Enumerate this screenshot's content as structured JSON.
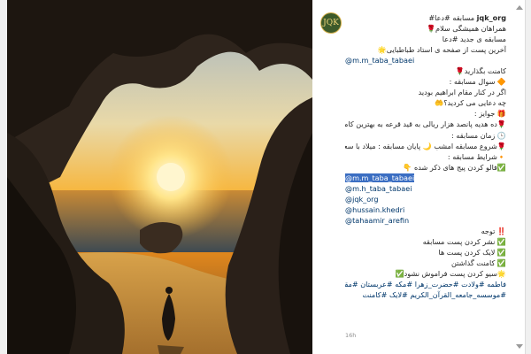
{
  "post": {
    "username": "jqk_org",
    "avatar_text": "JQK",
    "caption_lines": [
      {
        "text": "مسابقه #دعا#",
        "style": "normal",
        "prefix_user": true
      },
      {
        "text": "همراهان همیشگی سلام🌹",
        "style": "normal"
      },
      {
        "text": "مسابقه ی جدید #دعا",
        "style": "normal"
      },
      {
        "text": "آخرین پست از صفحه ی استاد طباطبایی🌟",
        "style": "normal"
      },
      {
        "text": "@m.m_taba_tabaei",
        "style": "mention"
      },
      {
        "text": "کامنت بگذارید🌹",
        "style": "normal"
      },
      {
        "text": "🔶 سوال مسابقه :",
        "style": "normal"
      },
      {
        "text": "اگر در کنار مقام ابراهیم بودید",
        "style": "normal"
      },
      {
        "text": "چه دعایی می کردید؟🤲",
        "style": "normal"
      },
      {
        "text": "🎁 جوایز :",
        "style": "normal"
      },
      {
        "text": "🌹ده هدیه پانصد هزار ریالی به قید قرعه به بهترین کامنت ها",
        "style": "normal"
      },
      {
        "text": "🕒 زمان مسابقه :",
        "style": "normal"
      },
      {
        "text": "🌹شروع مسابقه امشب 🌙 پایان مسابقه : میلاد با سعادت حضرت فاطمه (س)",
        "style": "normal"
      },
      {
        "text": "🔸شرایط مسابقه :",
        "style": "normal"
      },
      {
        "text": "✅فالو کردن پیج های ذکر شده 👇",
        "style": "normal"
      },
      {
        "text": "@m.m_taba_tabaei",
        "style": "mention-selected"
      },
      {
        "text": "@m.h_taba_tabaei",
        "style": "mention"
      },
      {
        "text": "@jqk_org",
        "style": "mention"
      },
      {
        "text": "@hussain.khedri",
        "style": "mention"
      },
      {
        "text": "@tahaamir_arefin",
        "style": "mention"
      },
      {
        "text": "‼️ توجه",
        "style": "normal"
      },
      {
        "text": "✅ نشر کردن پست مسابقه",
        "style": "normal"
      },
      {
        "text": "✅ لایک کردن پست ها",
        "style": "normal"
      },
      {
        "text": "✅ کامنت گذاشتن",
        "style": "normal"
      },
      {
        "text": "🌟سیو کردن پست فراموش نشود✅",
        "style": "normal"
      },
      {
        "text": "فاطمه #ولادت #حضرت_زهرا #مکه #عربستان #مقام_ابراهیم #کعبه #طباطبایی",
        "style": "link"
      },
      {
        "text": "#موسسه_جامعه_القرآن_الکریم #لایک #کامنت",
        "style": "link"
      }
    ],
    "timestamp": "16h"
  },
  "photo": {
    "description_icon": "cave-sunset-photo"
  },
  "colors": {
    "mention": "#00376b",
    "selection": "#3b6ec2",
    "text": "#262626",
    "muted": "#8e8e8e"
  }
}
